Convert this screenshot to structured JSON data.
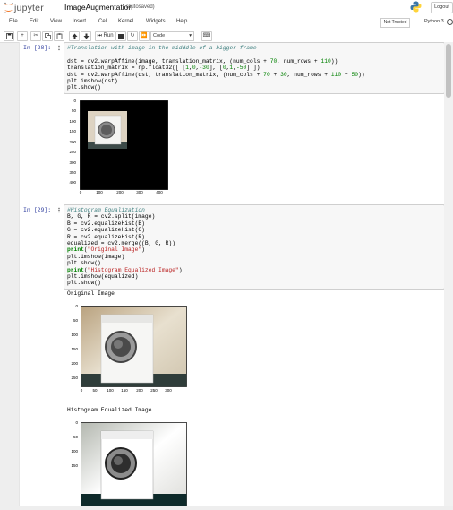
{
  "header": {
    "logo_text": "jupyter",
    "notebook_title": "ImageAugmentation",
    "autosaved": "(autosaved)",
    "logout_label": "Logout"
  },
  "menu": {
    "items": [
      "File",
      "Edit",
      "View",
      "Insert",
      "Cell",
      "Kernel",
      "Widgets",
      "Help"
    ],
    "trusted_label": "Not Trusted",
    "kernel_label": "Python 3"
  },
  "toolbar": {
    "run_label": "Run",
    "cell_type": "Code"
  },
  "cells": [
    {
      "prompt": "In [28]:",
      "code_lines": [
        "#Translation with image in the midddle of a bigger frame",
        "",
        "dst = cv2.warpAffine(image, translation_matrix, (num_cols + 70, num_rows + 110))",
        "translation_matrix = np.float32([ [1,0,-30], [0,1,-50] ])",
        "dst = cv2.warpAffine(dst, translation_matrix, (num_cols + 70 + 30, num_rows + 110 + 50))",
        "plt.imshow(dst)",
        "plt.show()"
      ],
      "plot": {
        "yticks": [
          "0",
          "50",
          "100",
          "150",
          "200",
          "250",
          "300",
          "350",
          "400"
        ],
        "xticks": [
          "0",
          "100",
          "200",
          "300",
          "400"
        ]
      }
    },
    {
      "prompt": "In [29]:",
      "code_lines": [
        "#Histogram Equalization",
        "B, G, R = cv2.split(image)",
        "B = cv2.equalizeHist(B)",
        "G = cv2.equalizeHist(G)",
        "R = cv2.equalizeHist(R)",
        "equalized = cv2.merge((B, G, R))",
        "print(\"Original Image\")",
        "plt.imshow(image)",
        "plt.show()",
        "print(\"Histogram Equalized Image\")",
        "plt.imshow(equalized)",
        "plt.show()"
      ],
      "output_1": "Original Image",
      "plot_1": {
        "yticks": [
          "0",
          "50",
          "100",
          "150",
          "200",
          "250"
        ],
        "xticks": [
          "0",
          "50",
          "100",
          "150",
          "200",
          "250",
          "300"
        ]
      },
      "output_2": "Histogram Equalized Image",
      "plot_2": {
        "yticks": [
          "0",
          "50",
          "100",
          "150"
        ]
      }
    }
  ],
  "colors": {
    "prompt": "#303f9f",
    "comment": "#408080",
    "string": "#ba2121",
    "number": "#008000",
    "logo_orange": "#f37626"
  }
}
